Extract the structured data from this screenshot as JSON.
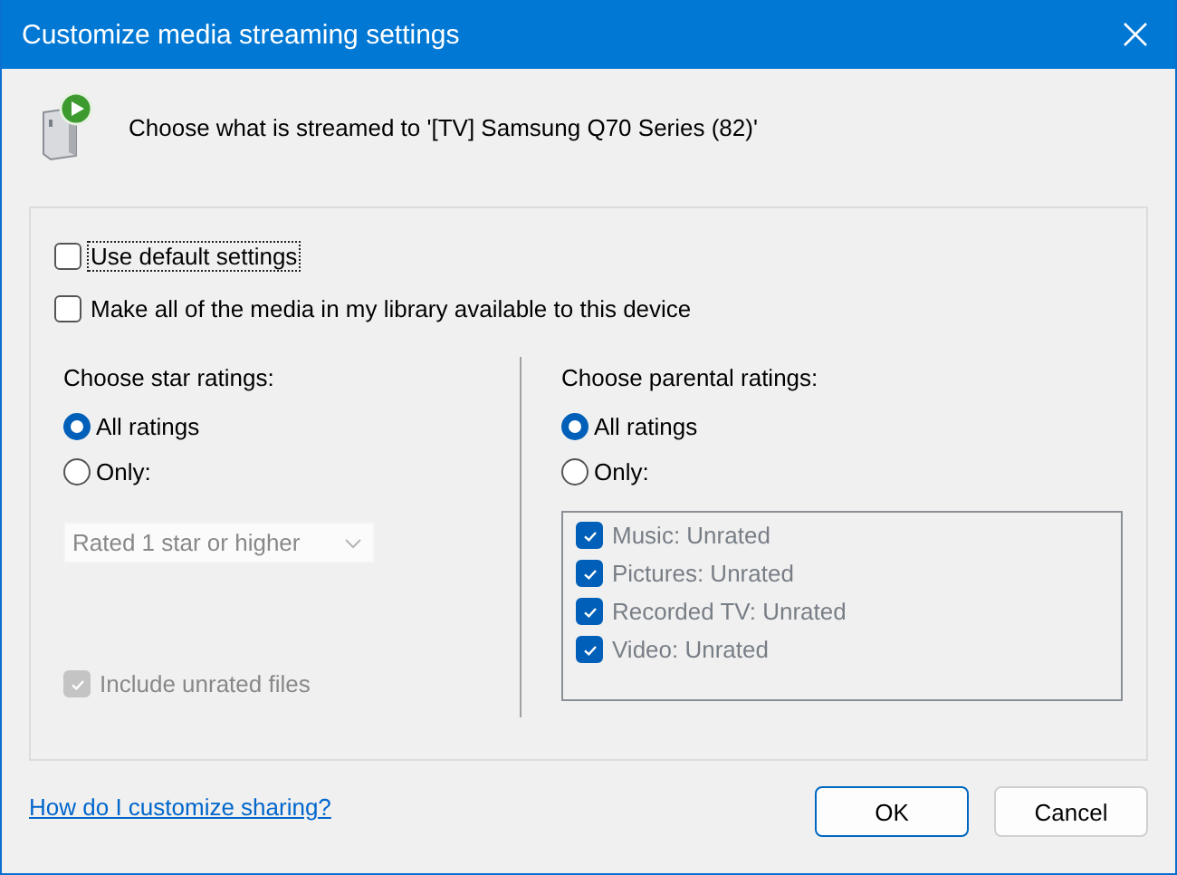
{
  "window": {
    "title": "Customize media streaming settings"
  },
  "header": {
    "text": "Choose what is streamed to '[TV] Samsung Q70 Series (82)'"
  },
  "options": [
    {
      "label": "Use default settings",
      "checked": false,
      "focused": true
    },
    {
      "label": "Make all of the media in my library available to this device",
      "checked": false,
      "focused": false
    }
  ],
  "star_ratings": {
    "heading": "Choose star ratings:",
    "radios": [
      {
        "label": "All ratings",
        "selected": true
      },
      {
        "label": "Only:",
        "selected": false
      }
    ],
    "dropdown": {
      "value": "Rated 1 star or higher",
      "disabled": true
    },
    "include_unrated": {
      "label": "Include unrated files",
      "checked": true,
      "disabled": true
    }
  },
  "parental_ratings": {
    "heading": "Choose parental ratings:",
    "radios": [
      {
        "label": "All ratings",
        "selected": true
      },
      {
        "label": "Only:",
        "selected": false
      }
    ],
    "list_disabled": true,
    "list": [
      {
        "label": "Music: Unrated",
        "checked": true
      },
      {
        "label": "Pictures: Unrated",
        "checked": true
      },
      {
        "label": "Recorded TV: Unrated",
        "checked": true
      },
      {
        "label": "Video: Unrated",
        "checked": true
      }
    ]
  },
  "link": "How do I customize sharing?",
  "buttons": [
    {
      "label": "OK",
      "default": true
    },
    {
      "label": "Cancel",
      "default": false
    }
  ]
}
